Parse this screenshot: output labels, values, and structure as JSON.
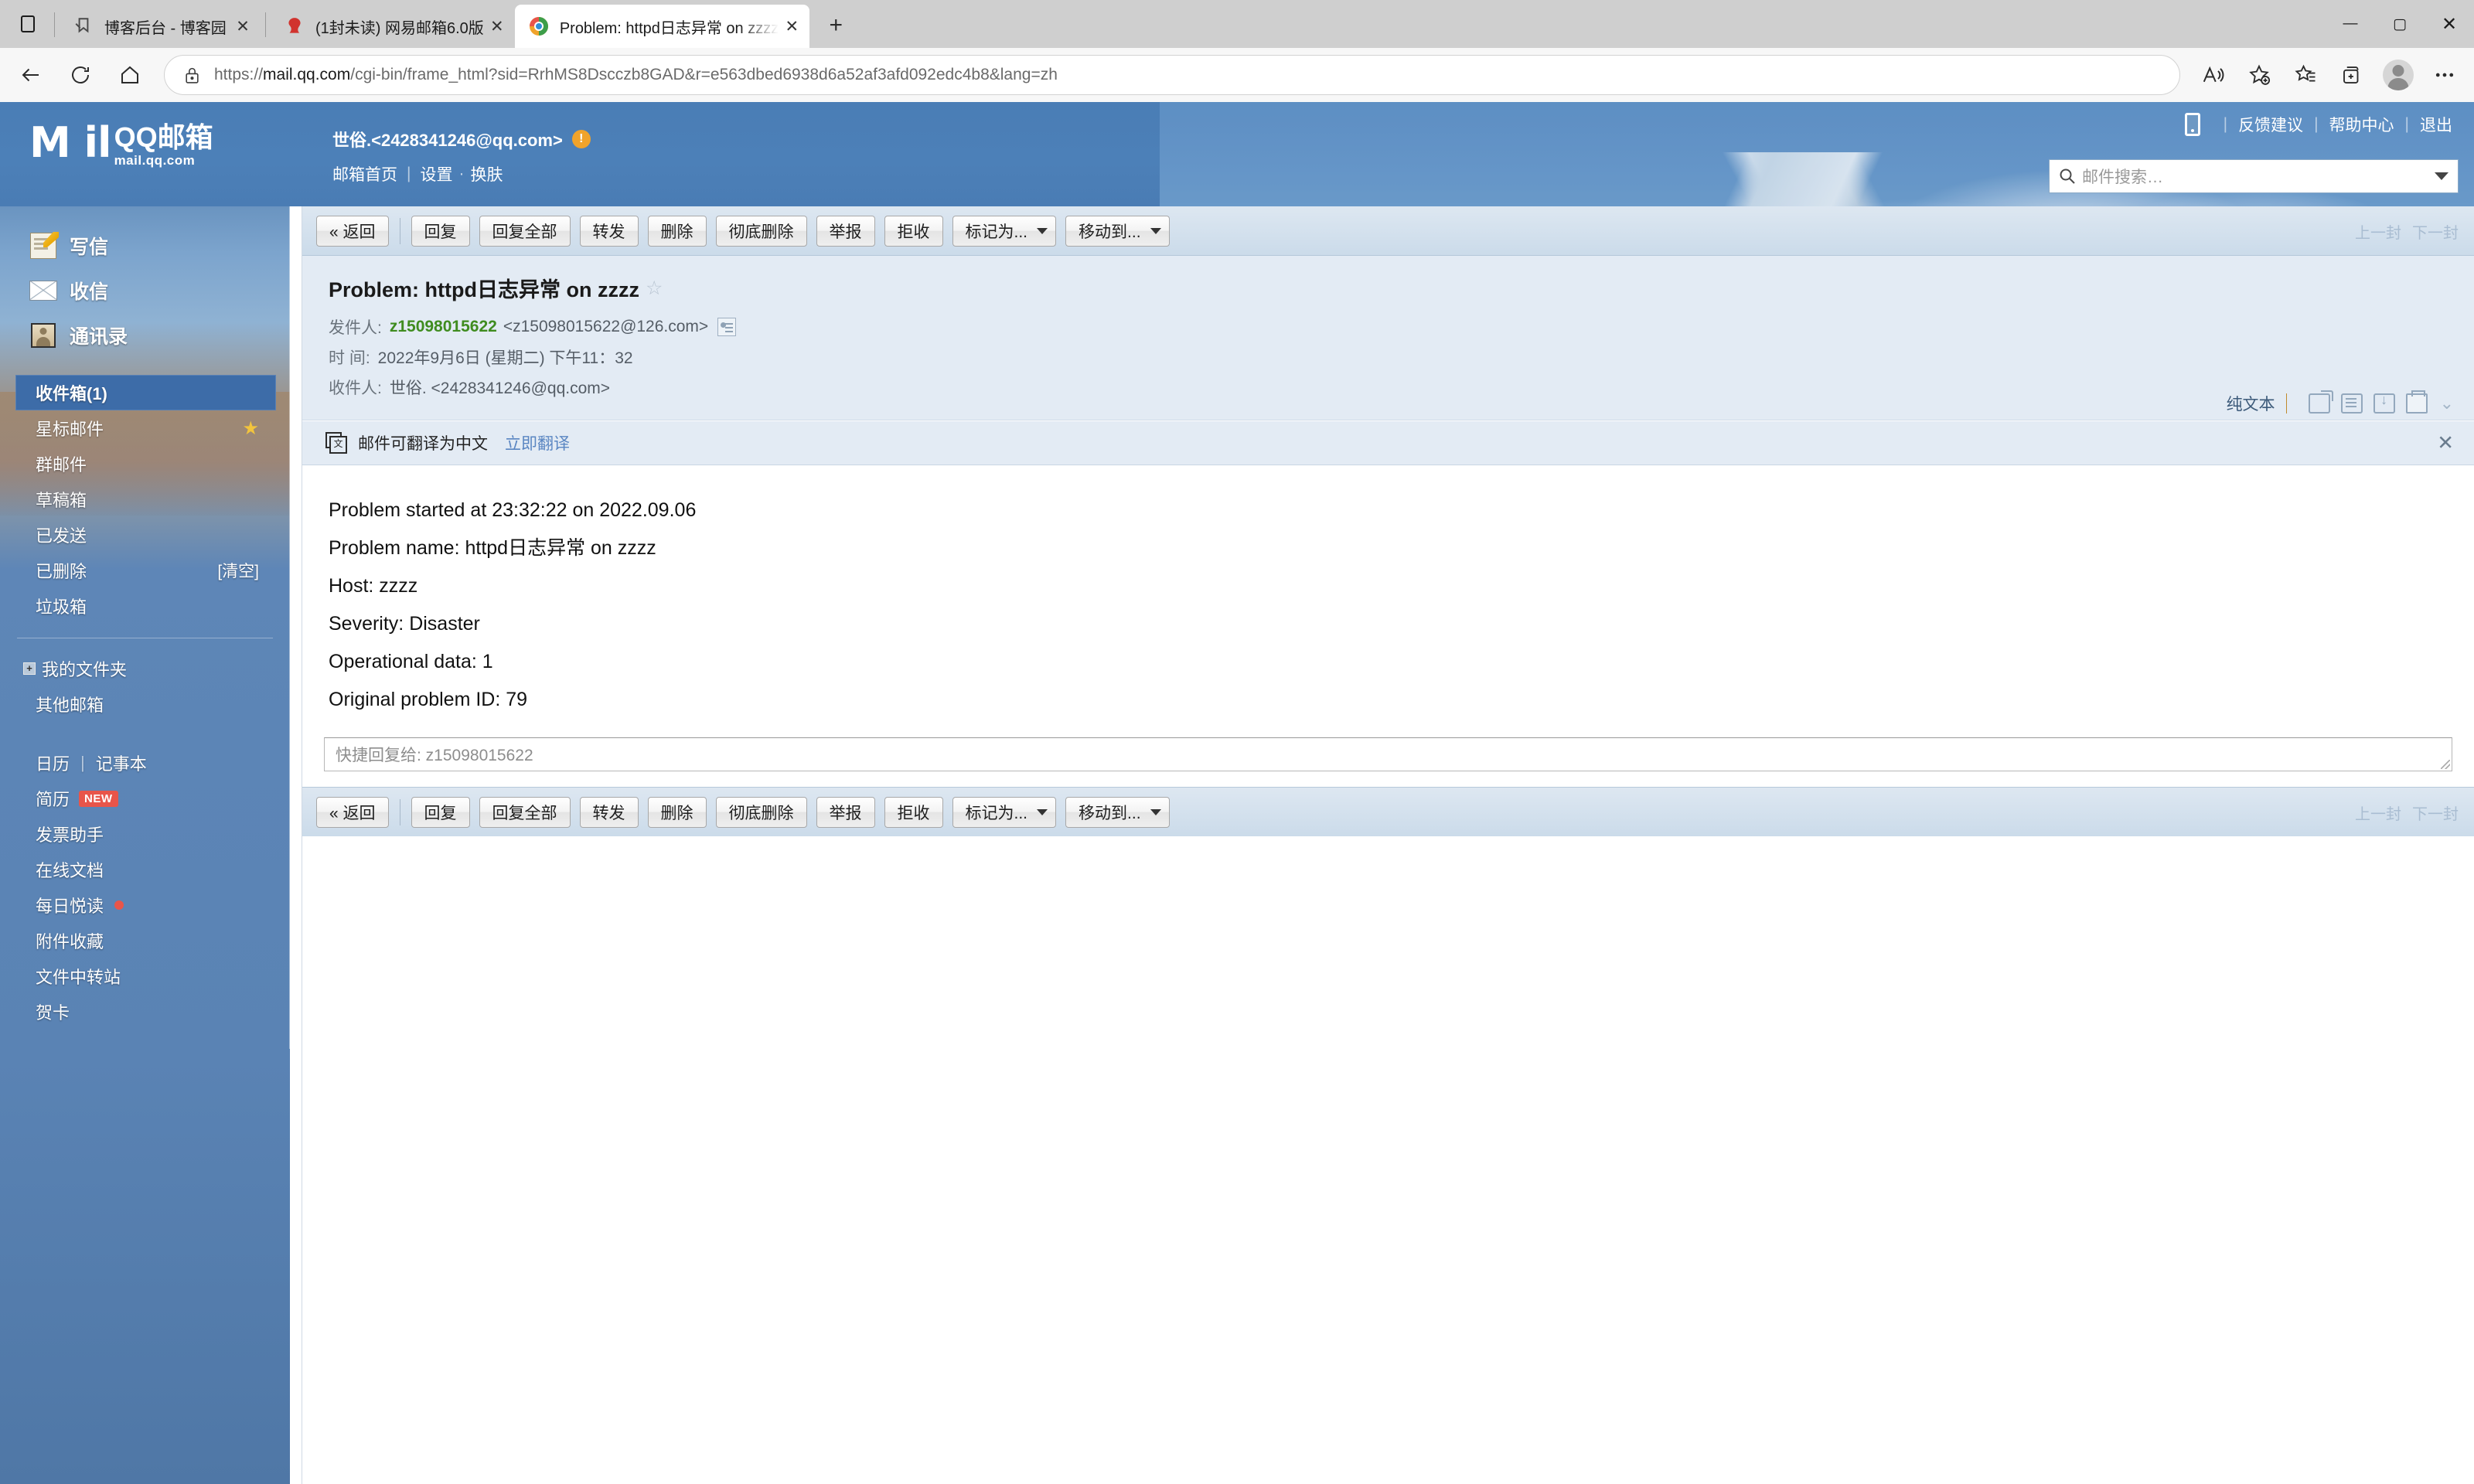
{
  "browser": {
    "tabs": [
      {
        "title": "博客后台 - 博客园",
        "favicon": "bookmark-icon",
        "active": false
      },
      {
        "title": "(1封未读) 网易邮箱6.0版",
        "favicon": "netease-icon",
        "active": false
      },
      {
        "title": "Problem: httpd日志异常 on zzzz",
        "favicon": "qqmail-icon",
        "active": true
      }
    ],
    "tab_close_label": "✕",
    "new_tab_label": "+",
    "window_controls": {
      "minimize": "—",
      "maximize": "▢",
      "close": "✕"
    },
    "url_prefix": "https://",
    "url_host": "mail.qq.com",
    "url_path": "/cgi-bin/frame_html?sid=RrhMS8Dscczb8GAD&r=e563dbed6938d6a52af3afd092edc4b8&lang=zh"
  },
  "header": {
    "logo_mark": "M il",
    "logo_sub": "mail.qq.com",
    "logo_cn_big": "QQ邮箱",
    "logo_cn_small": "mail.qq.com",
    "account": "世俗.<2428341246@qq.com>",
    "warn_badge": "!",
    "nav": {
      "home": "邮箱首页",
      "settings": "设置",
      "skin": "换肤"
    },
    "right_links": {
      "feedback": "反馈建议",
      "help": "帮助中心",
      "logout": "退出"
    },
    "search_placeholder": "邮件搜索…"
  },
  "sidebar": {
    "main_items": [
      {
        "label": "写信",
        "icon": "compose-icon"
      },
      {
        "label": "收信",
        "icon": "inbox-icon"
      },
      {
        "label": "通讯录",
        "icon": "contacts-icon"
      }
    ],
    "folders": [
      {
        "label": "收件箱(1)",
        "selected": true
      },
      {
        "label": "星标邮件",
        "star": "★"
      },
      {
        "label": "群邮件"
      },
      {
        "label": "草稿箱"
      },
      {
        "label": "已发送"
      },
      {
        "label": "已删除",
        "action": "[清空]"
      },
      {
        "label": "垃圾箱"
      }
    ],
    "my_folders": "我的文件夹",
    "other_mail": "其他邮箱",
    "tools": [
      {
        "label": "日历",
        "label2": "记事本"
      },
      {
        "label": "简历",
        "badge": "NEW"
      },
      {
        "label": "发票助手"
      },
      {
        "label": "在线文档"
      },
      {
        "label": "每日悦读",
        "dot": true
      },
      {
        "label": "附件收藏"
      },
      {
        "label": "文件中转站"
      },
      {
        "label": "贺卡"
      }
    ]
  },
  "toolbar": {
    "back": "« 返回",
    "reply": "回复",
    "reply_all": "回复全部",
    "forward": "转发",
    "delete": "删除",
    "delete_forever": "彻底删除",
    "report": "举报",
    "reject": "拒收",
    "mark_as": "标记为...",
    "move_to": "移动到...",
    "prev_mail": "上一封",
    "next_mail": "下一封"
  },
  "mail": {
    "subject": "Problem: httpd日志异常 on zzzz",
    "star": "☆",
    "from_label": "发件人:",
    "from_name": "z15098015622",
    "from_addr": "<z15098015622@126.com>",
    "time_label": "时  间:",
    "time_value": "2022年9月6日 (星期二) 下午11：32",
    "to_label": "收件人:",
    "to_value": "世俗. <2428341246@qq.com>",
    "view_mode": "纯文本",
    "translate_text": "邮件可翻译为中文",
    "translate_link": "立即翻译",
    "translate_close": "✕",
    "body_lines": [
      "Problem started at 23:32:22 on 2022.09.06",
      "Problem name: httpd日志异常 on zzzz",
      "Host: zzzz",
      "Severity: Disaster",
      "Operational data: 1",
      "Original problem ID: 79"
    ],
    "quick_reply_placeholder": "快捷回复给:  z15098015622"
  }
}
